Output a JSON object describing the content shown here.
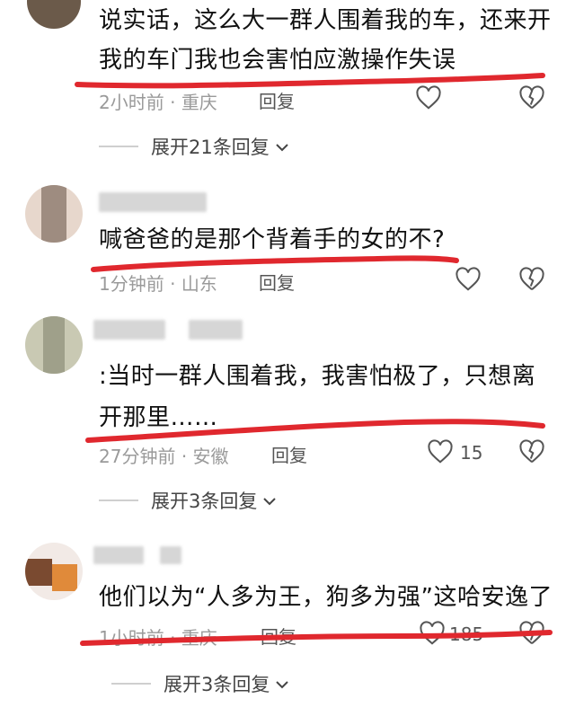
{
  "comments": [
    {
      "text_line1": "说实话，这么大一群人围着我的车，还来开",
      "text_line2": "我的车门我也会害怕应激操作失误",
      "time": "2小时前",
      "location": "重庆",
      "reply_label": "回复",
      "likes": "",
      "expand_label": "展开21条回复"
    },
    {
      "text_line1": "喊爸爸的是那个背着手的女的不?",
      "time": "1分钟前",
      "location": "山东",
      "reply_label": "回复",
      "likes": ""
    },
    {
      "text_line1": ":当时一群人围着我，我害怕极了，只想离",
      "text_line2": "开那里……",
      "time": "27分钟前",
      "location": "安徽",
      "reply_label": "回复",
      "likes": "15",
      "expand_label": "展开3条回复"
    },
    {
      "text_line1": "他们以为“人多为王，狗多为强”这哈安逸了",
      "time": "1小时前",
      "location": "重庆",
      "reply_label": "回复",
      "likes": "185",
      "expand_label": "展开3条回复"
    }
  ],
  "meta_separator": "·",
  "icons": {
    "like": "heart-outline",
    "dislike": "broken-heart",
    "expand": "chevron-down"
  },
  "colors": {
    "underline": "#e0282e",
    "meta": "#9a9a9a"
  }
}
